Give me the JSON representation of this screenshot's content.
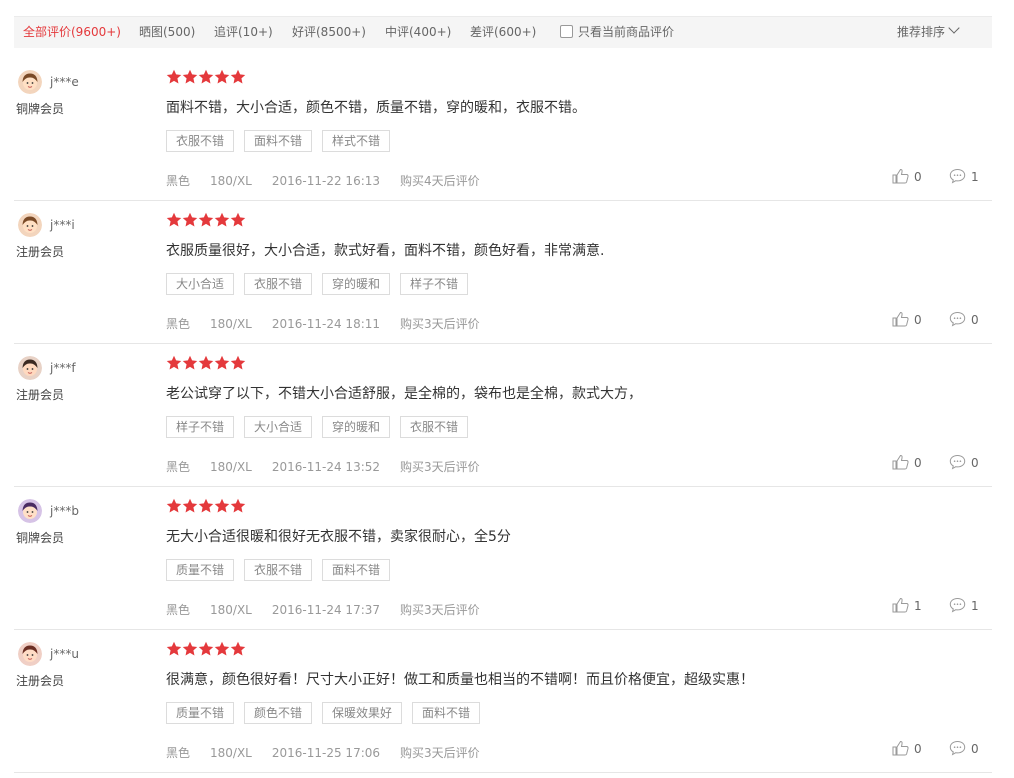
{
  "filter": {
    "tabs": [
      {
        "label": "全部评价(9600+)",
        "active": true
      },
      {
        "label": "晒图(500)"
      },
      {
        "label": "追评(10+)"
      },
      {
        "label": "好评(8500+)"
      },
      {
        "label": "中评(400+)"
      },
      {
        "label": "差评(600+)"
      }
    ],
    "only_current_label": "只看当前商品评价",
    "sort_label": "推荐排序"
  },
  "colors": {
    "accent": "#e4393c",
    "star": "#e4393c"
  },
  "reviews": [
    {
      "username": "j***e",
      "level": "铜牌会员",
      "rating": 5,
      "comment": "面料不错，大小合适，颜色不错，质量不错，穿的暖和，衣服不错。",
      "tags": [
        "衣服不错",
        "面料不错",
        "样式不错"
      ],
      "color": "黑色",
      "size": "180/XL",
      "date": "2016-11-22 16:13",
      "after": "购买4天后评价",
      "likes": "0",
      "replies": "1",
      "avatar_style": "a"
    },
    {
      "username": "j***i",
      "level": "注册会员",
      "rating": 5,
      "comment": "衣服质量很好，大小合适，款式好看，面料不错，颜色好看，非常满意.",
      "tags": [
        "大小合适",
        "衣服不错",
        "穿的暖和",
        "样子不错"
      ],
      "color": "黑色",
      "size": "180/XL",
      "date": "2016-11-24 18:11",
      "after": "购买3天后评价",
      "likes": "0",
      "replies": "0",
      "avatar_style": "a"
    },
    {
      "username": "j***f",
      "level": "注册会员",
      "rating": 5,
      "comment": "老公试穿了以下，不错大小合适舒服，是全棉的，袋布也是全棉，款式大方，",
      "tags": [
        "样子不错",
        "大小合适",
        "穿的暖和",
        "衣服不错"
      ],
      "color": "黑色",
      "size": "180/XL",
      "date": "2016-11-24 13:52",
      "after": "购买3天后评价",
      "likes": "0",
      "replies": "0",
      "avatar_style": "b"
    },
    {
      "username": "j***b",
      "level": "铜牌会员",
      "rating": 5,
      "comment": "无大小合适很暖和很好无衣服不错，卖家很耐心，全5分",
      "tags": [
        "质量不错",
        "衣服不错",
        "面料不错"
      ],
      "color": "黑色",
      "size": "180/XL",
      "date": "2016-11-24 17:37",
      "after": "购买3天后评价",
      "likes": "1",
      "replies": "1",
      "avatar_style": "c"
    },
    {
      "username": "j***u",
      "level": "注册会员",
      "rating": 5,
      "comment": "很满意，颜色很好看！尺寸大小正好！做工和质量也相当的不错啊！而且价格便宜，超级实惠！",
      "tags": [
        "质量不错",
        "颜色不错",
        "保暖效果好",
        "面料不错"
      ],
      "color": "黑色",
      "size": "180/XL",
      "date": "2016-11-25 17:06",
      "after": "购买3天后评价",
      "likes": "0",
      "replies": "0",
      "avatar_style": "d"
    }
  ]
}
